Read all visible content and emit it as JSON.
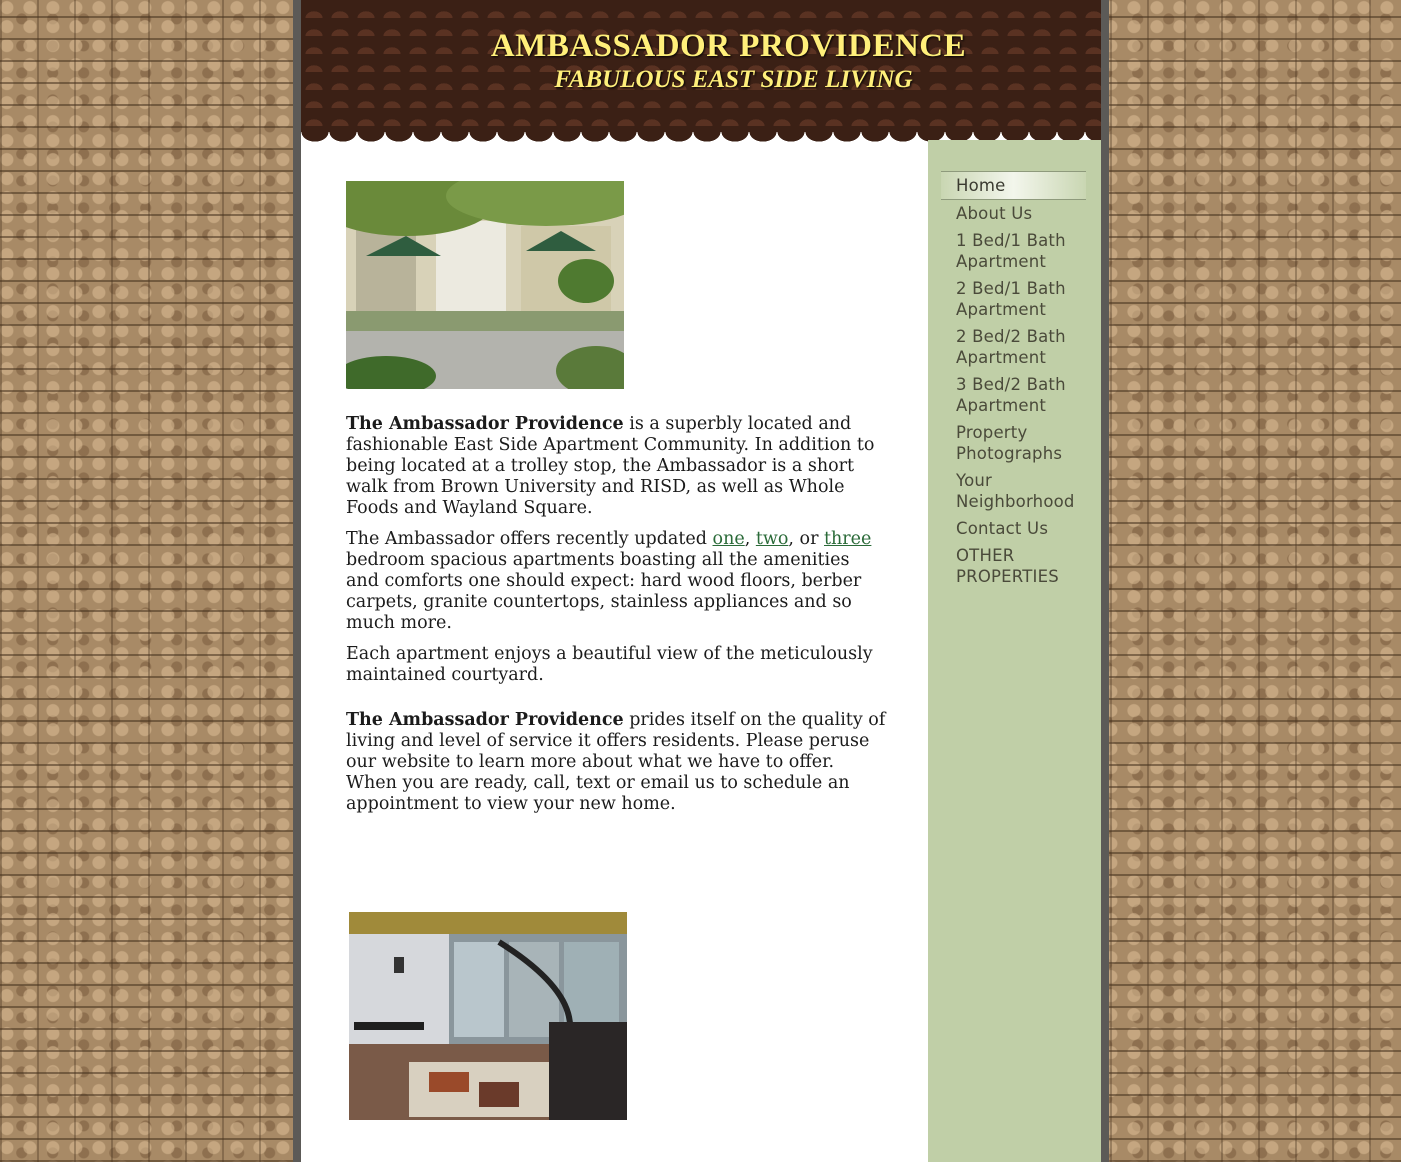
{
  "header": {
    "title": "AMBASSADOR PROVIDENCE",
    "subtitle": "FABULOUS EAST SIDE LIVING"
  },
  "nav": {
    "items": [
      {
        "label": "Home",
        "active": true
      },
      {
        "label": "About Us"
      },
      {
        "label": "1 Bed/1 Bath Apartment"
      },
      {
        "label": "2 Bed/1 Bath Apartment"
      },
      {
        "label": "2 Bed/2 Bath Apartment"
      },
      {
        "label": "3 Bed/2 Bath Apartment"
      },
      {
        "label": "Property Photographs"
      },
      {
        "label": "Your Neighborhood"
      },
      {
        "label": "Contact Us"
      },
      {
        "label": "OTHER PROPERTIES"
      }
    ]
  },
  "content": {
    "p1_bold": "The Ambassador Providence",
    "p1_rest": " is a superbly located and fashionable East Side Apartment Community.  In addition to being located at a trolley stop, the Ambassador is a short walk from Brown University and RISD, as well as Whole Foods and Wayland Square.",
    "p2_start": "The Ambassador offers recently updated ",
    "link_one": "one",
    "p2_sep1": ", ",
    "link_two": "two",
    "p2_sep2": ", or  ",
    "link_three": "three",
    "p2_end": " bedroom spacious apartments boasting all the amenities and comforts one should expect: hard wood floors, berber carpets, granite countertops, stainless appliances and so much more.",
    "p3": "Each apartment enjoys a beautiful view of the meticulously maintained courtyard.",
    "p4_bold": "The Ambassador Providence",
    "p4_rest": " prides itself on the quality of living and level of service it offers residents.  Please peruse our website to learn more about what we have to offer. When you are ready, call, text or email us to schedule an appointment to view your new home."
  },
  "colors": {
    "header_bg": "#3b2015",
    "title_text": "#ffef7a",
    "sidebar_bg": "#c0cfa7",
    "link": "#2a6a38"
  }
}
